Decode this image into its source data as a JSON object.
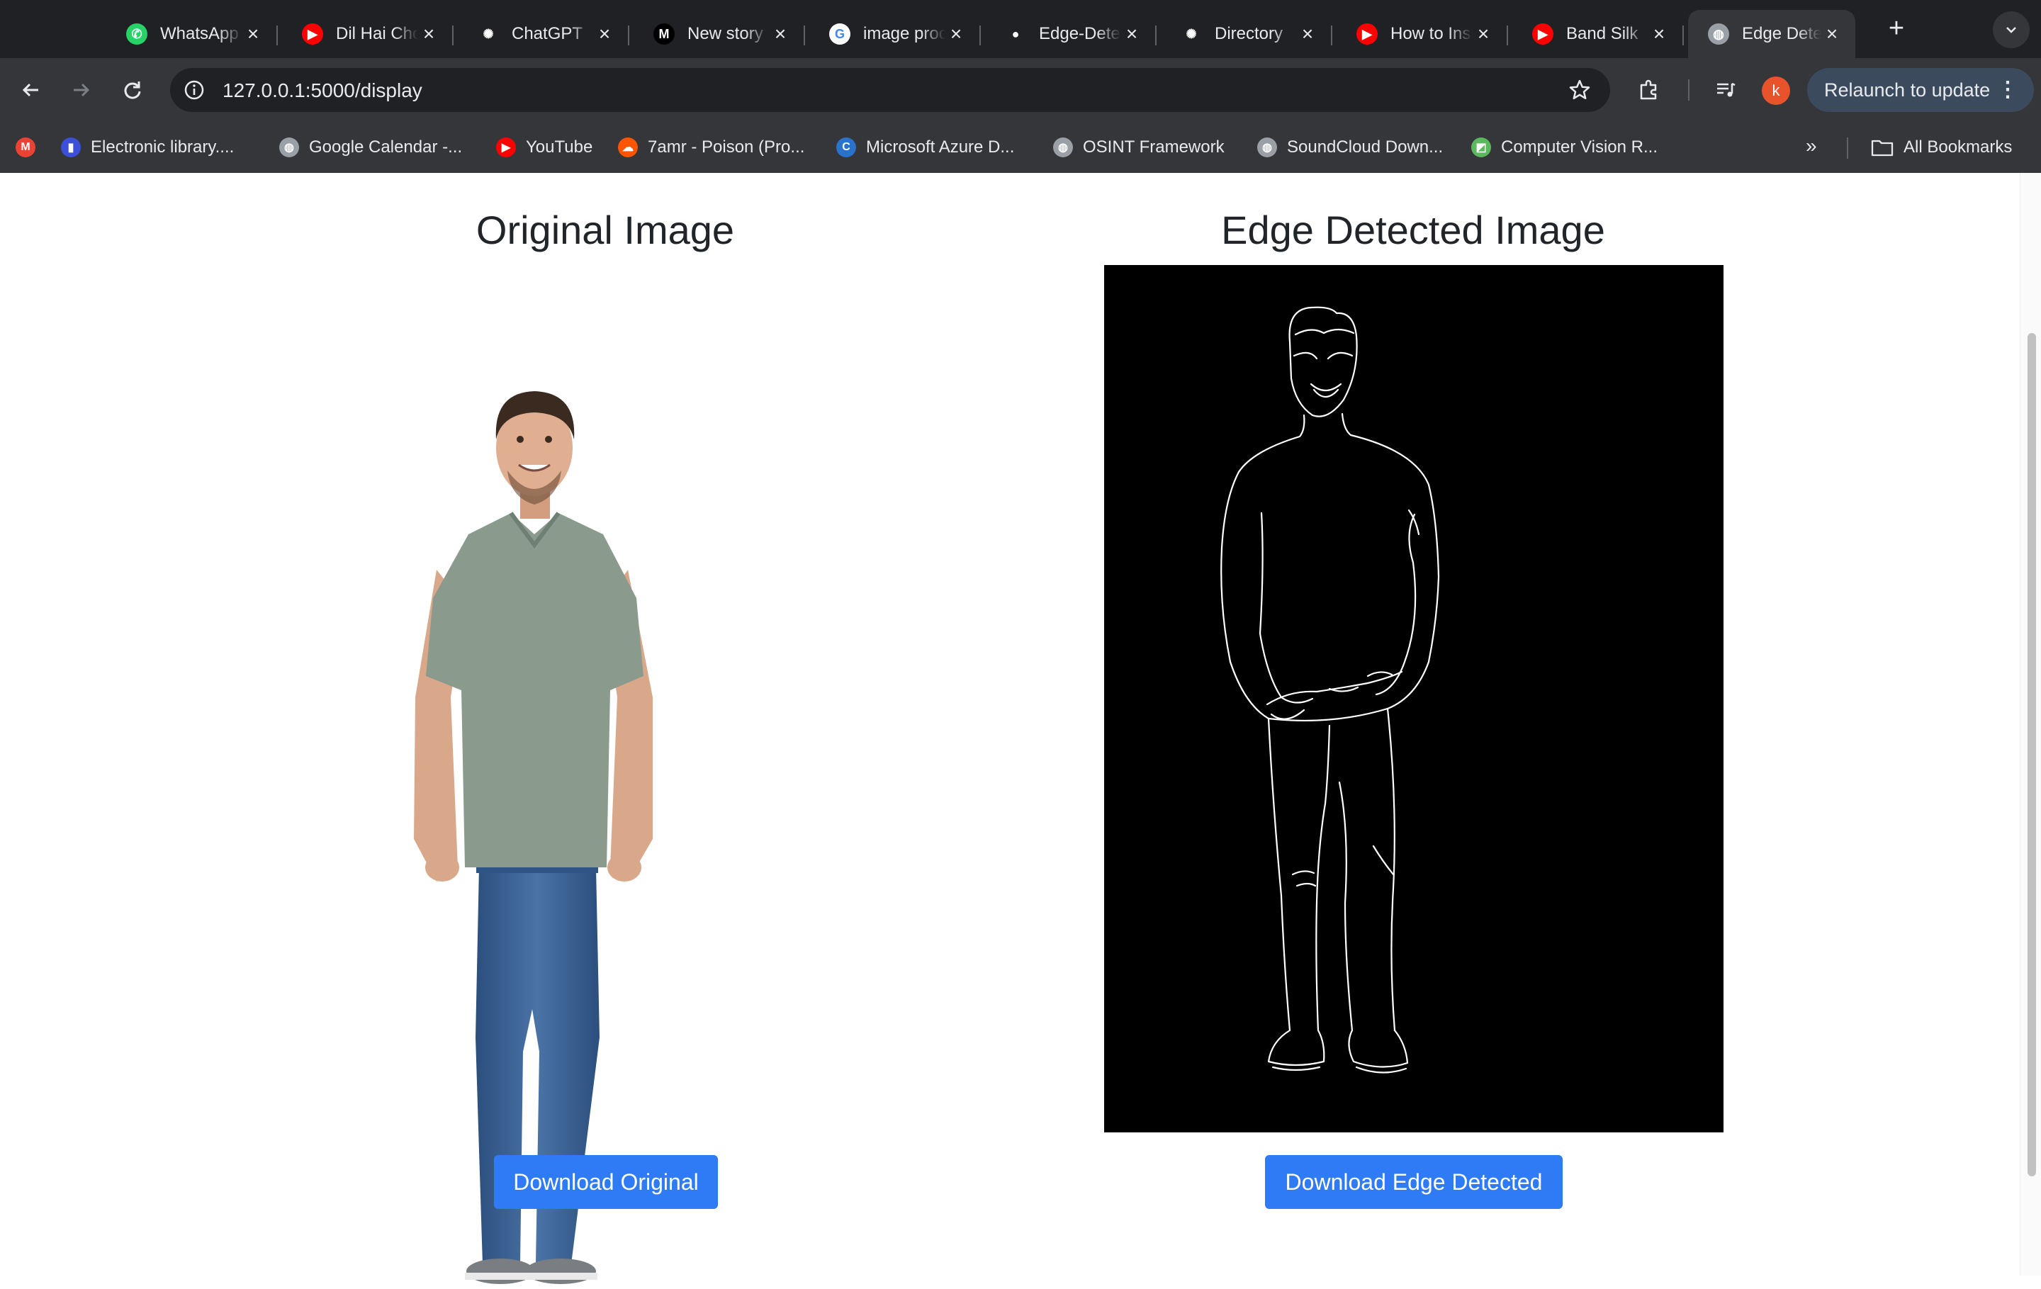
{
  "browser": {
    "tabs": [
      {
        "title": "WhatsApp",
        "icon": "whatsapp-icon",
        "color": "#25d366",
        "glyph": "✆"
      },
      {
        "title": "Dil Hai Chota",
        "icon": "youtube-icon",
        "color": "#ff0000",
        "glyph": "▶"
      },
      {
        "title": "ChatGPT",
        "icon": "chatgpt-icon",
        "color": "#202124",
        "glyph": "✺"
      },
      {
        "title": "New story",
        "icon": "medium-icon",
        "color": "#000000",
        "glyph": "M"
      },
      {
        "title": "image processing",
        "icon": "google-icon",
        "color": "#ffffff",
        "glyph": "G"
      },
      {
        "title": "Edge-Detection",
        "icon": "github-icon",
        "color": "#202124",
        "glyph": "●"
      },
      {
        "title": "Directory",
        "icon": "chatgpt-icon",
        "color": "#202124",
        "glyph": "✺"
      },
      {
        "title": "How to Install",
        "icon": "youtube-icon",
        "color": "#ff0000",
        "glyph": "▶"
      },
      {
        "title": "Band Silk",
        "icon": "youtube-icon",
        "color": "#ff0000",
        "glyph": "▶"
      },
      {
        "title": "Edge Detection",
        "icon": "globe-icon",
        "color": "#9aa0a6",
        "glyph": "◍"
      }
    ],
    "active_tab": 9,
    "url": "127.0.0.1:5000/display",
    "profile_initial": "k",
    "relaunch_label": "Relaunch to update",
    "bookmarks": [
      {
        "title": "",
        "icon": "gmail-icon",
        "color": "#ea4335",
        "glyph": "M"
      },
      {
        "title": "Electronic library....",
        "icon": "library-icon",
        "color": "#3b4fd8",
        "glyph": "▮"
      },
      {
        "title": "Google Calendar -...",
        "icon": "globe-icon",
        "color": "#9aa0a6",
        "glyph": "◍"
      },
      {
        "title": "YouTube",
        "icon": "youtube-icon",
        "color": "#ff0000",
        "glyph": "▶"
      },
      {
        "title": "7amr - Poison (Pro...",
        "icon": "soundcloud-icon",
        "color": "#ff5500",
        "glyph": "☁"
      },
      {
        "title": "Microsoft Azure D...",
        "icon": "coursera-icon",
        "color": "#2a73cc",
        "glyph": "C"
      },
      {
        "title": "OSINT Framework",
        "icon": "globe-icon",
        "color": "#9aa0a6",
        "glyph": "◍"
      },
      {
        "title": "SoundCloud Down...",
        "icon": "globe-icon",
        "color": "#9aa0a6",
        "glyph": "◍"
      },
      {
        "title": "Computer Vision R...",
        "icon": "cv-icon",
        "color": "#5cb85c",
        "glyph": "◩"
      }
    ],
    "all_bookmarks_label": "All Bookmarks"
  },
  "page": {
    "original_title": "Original Image",
    "edge_title": "Edge Detected Image",
    "download_original_label": "Download Original",
    "download_edge_label": "Download Edge Detected",
    "button_color": "#2f7bf5"
  }
}
